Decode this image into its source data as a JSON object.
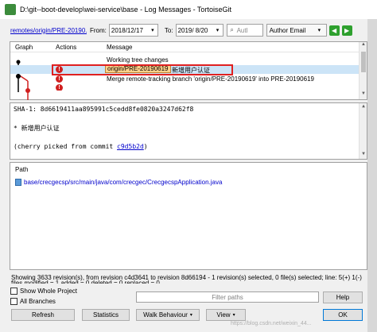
{
  "window": {
    "title": "D:\\git--boot-develop\\wei-service\\base - Log Messages - TortoiseGit"
  },
  "toolbar": {
    "branch": "remotes/origin/PRE-20190...",
    "from_label": "From:",
    "from_date": "2018/12/17",
    "to_label": "To:",
    "to_date": "2019/ 8/20",
    "search_placeholder": "Autl",
    "filter_select": "Author Email"
  },
  "log": {
    "columns": [
      "Graph",
      "Actions",
      "Message"
    ],
    "rows": [
      {
        "message": "Working tree changes",
        "has_action": false,
        "selected": false
      },
      {
        "branch_tag": "origin/PRE-20190619",
        "message": "新增用户认证",
        "has_action": true,
        "selected": true
      },
      {
        "message": "Merge remote-tracking branch 'origin/PRE-20190619' into PRE-20190619",
        "has_action": true,
        "selected": false
      }
    ]
  },
  "detail": {
    "sha_line": "SHA-1: 8d6619411aa895991c5cedd8fe0820a3247d62f8",
    "subject": "* 新增用户认证",
    "cherry_prefix": "(cherry picked from commit ",
    "cherry_hash": "c9d5b2d",
    "cherry_suffix": ")"
  },
  "paths": {
    "header": "Path",
    "file": "base/crecgecsp/src/main/java/com/crecgec/CrecgecspApplication.java"
  },
  "status": {
    "line1": "Showing 3633 revision(s), from revision c4d3641 to revision 8d66194 - 1 revision(s) selected, 0 file(s) selected; line: 5(+) 1(-)",
    "line2": "files modified = 1 added = 0 deleted = 0 replaced = 0"
  },
  "options": {
    "show_whole_project": "Show Whole Project",
    "all_branches": "All Branches",
    "filter_paths_placeholder": "Filter paths"
  },
  "buttons": {
    "help": "Help",
    "refresh": "Refresh",
    "statistics": "Statistics",
    "walk_behaviour": "Walk Behaviour",
    "view": "View",
    "ok": "OK"
  },
  "watermark": "https://blog.csdn.net/weixin_44..."
}
